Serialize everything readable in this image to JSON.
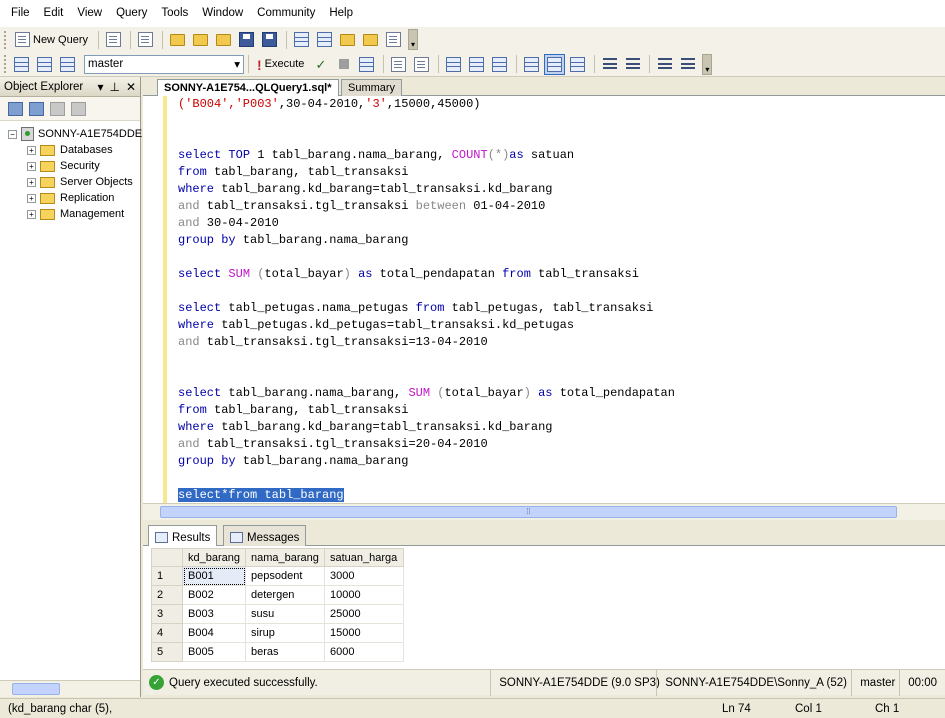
{
  "menu": [
    "File",
    "Edit",
    "View",
    "Query",
    "Tools",
    "Window",
    "Community",
    "Help"
  ],
  "toolbar": {
    "new_query_label": "New Query",
    "database_selected": "master",
    "execute_label": "Execute"
  },
  "object_explorer": {
    "title": "Object Explorer",
    "server": "SONNY-A1E754DDE",
    "items": [
      "Databases",
      "Security",
      "Server Objects",
      "Replication",
      "Management"
    ]
  },
  "tabs": {
    "query": "SONNY-A1E754...QLQuery1.sql*",
    "summary": "Summary"
  },
  "results_tabs": {
    "results": "Results",
    "messages": "Messages"
  },
  "grid": {
    "headers": [
      "kd_barang",
      "nama_barang",
      "satuan_harga"
    ],
    "rows": [
      [
        "1",
        "B001",
        "pepsodent",
        "3000"
      ],
      [
        "2",
        "B002",
        "detergen",
        "10000"
      ],
      [
        "3",
        "B003",
        "susu",
        "25000"
      ],
      [
        "4",
        "B004",
        "sirup",
        "15000"
      ],
      [
        "5",
        "B005",
        "beras",
        "6000"
      ]
    ]
  },
  "status": {
    "message": "Query executed successfully.",
    "server": "SONNY-A1E754DDE (9.0 SP3)",
    "user": "SONNY-A1E754DDE\\Sonny_A (52)",
    "database": "master",
    "time": "00:00"
  },
  "app_status": {
    "left": "(kd_barang char (5),",
    "line": "Ln 74",
    "column": "Col 1",
    "char": "Ch 1"
  },
  "code_lines": [
    [
      [
        "str",
        "('B004','P003'"
      ],
      [
        "",
        ",30-04-2010,"
      ],
      [
        "str",
        "'3'"
      ],
      [
        "",
        ",15000,45000)"
      ]
    ],
    [],
    [],
    [
      [
        "kw",
        "select"
      ],
      [
        "",
        " "
      ],
      [
        "kw",
        "TOP"
      ],
      [
        "",
        " 1 tabl_barang.nama_barang, "
      ],
      [
        "fn",
        "COUNT"
      ],
      [
        "gray",
        "(*)"
      ],
      [
        "kw",
        "as"
      ],
      [
        "",
        " satuan"
      ]
    ],
    [
      [
        "kw",
        "from"
      ],
      [
        "",
        " tabl_barang, tabl_transaksi"
      ]
    ],
    [
      [
        "kw",
        "where"
      ],
      [
        "",
        " tabl_barang.kd_barang=tabl_transaksi.kd_barang"
      ]
    ],
    [
      [
        "gray",
        "and"
      ],
      [
        "",
        " tabl_transaksi.tgl_transaksi "
      ],
      [
        "gray",
        "between"
      ],
      [
        "",
        " 01-04-2010"
      ]
    ],
    [
      [
        "gray",
        "and"
      ],
      [
        "",
        " 30-04-2010"
      ]
    ],
    [
      [
        "kw",
        "group by"
      ],
      [
        "",
        " tabl_barang.nama_barang"
      ]
    ],
    [],
    [
      [
        "kw",
        "select"
      ],
      [
        "",
        " "
      ],
      [
        "fn",
        "SUM"
      ],
      [
        "",
        " "
      ],
      [
        "gray",
        "("
      ],
      [
        "",
        "total_bayar"
      ],
      [
        "gray",
        ")"
      ],
      [
        "",
        " "
      ],
      [
        "kw",
        "as"
      ],
      [
        "",
        " total_pendapatan "
      ],
      [
        "kw",
        "from"
      ],
      [
        "",
        " tabl_transaksi"
      ]
    ],
    [],
    [
      [
        "kw",
        "select"
      ],
      [
        "",
        " tabl_petugas.nama_petugas "
      ],
      [
        "kw",
        "from"
      ],
      [
        "",
        " tabl_petugas, tabl_transaksi"
      ]
    ],
    [
      [
        "kw",
        "where"
      ],
      [
        "",
        " tabl_petugas.kd_petugas=tabl_transaksi.kd_petugas"
      ]
    ],
    [
      [
        "gray",
        "and"
      ],
      [
        "",
        " tabl_transaksi.tgl_transaksi=13-04-2010"
      ]
    ],
    [],
    [],
    [
      [
        "kw",
        "select"
      ],
      [
        "",
        " tabl_barang.nama_barang, "
      ],
      [
        "fn",
        "SUM"
      ],
      [
        "",
        " "
      ],
      [
        "gray",
        "("
      ],
      [
        "",
        "total_bayar"
      ],
      [
        "gray",
        ")"
      ],
      [
        "",
        " "
      ],
      [
        "kw",
        "as"
      ],
      [
        "",
        " total_pendapatan"
      ]
    ],
    [
      [
        "kw",
        "from"
      ],
      [
        "",
        " tabl_barang, tabl_transaksi"
      ]
    ],
    [
      [
        "kw",
        "where"
      ],
      [
        "",
        " tabl_barang.kd_barang=tabl_transaksi.kd_barang"
      ]
    ],
    [
      [
        "gray",
        "and"
      ],
      [
        "",
        " tabl_transaksi.tgl_transaksi=20-04-2010"
      ]
    ],
    [
      [
        "kw",
        "group by"
      ],
      [
        "",
        " tabl_barang.nama_barang"
      ]
    ],
    [],
    [
      [
        "sel",
        "select*from tabl_barang"
      ]
    ]
  ]
}
